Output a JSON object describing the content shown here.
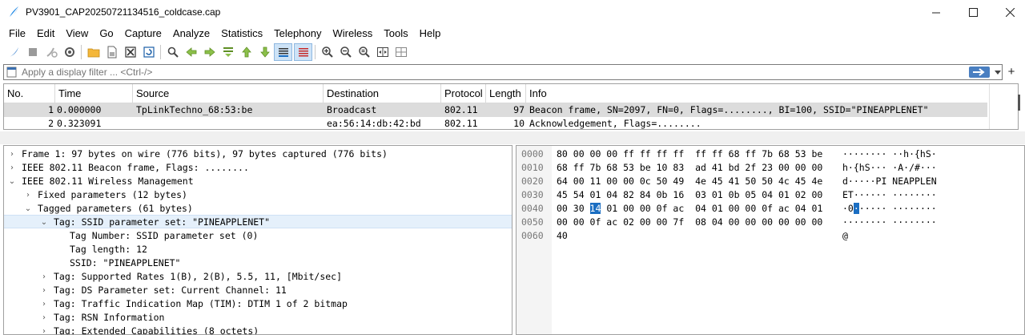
{
  "window": {
    "title": "PV3901_CAP20250721134516_coldcase.cap",
    "minimize": "—",
    "maximize": "☐",
    "close": "✕"
  },
  "menu": {
    "items": [
      "File",
      "Edit",
      "View",
      "Go",
      "Capture",
      "Analyze",
      "Statistics",
      "Telephony",
      "Wireless",
      "Tools",
      "Help"
    ]
  },
  "toolbar": {
    "icons": [
      "shark-fin-icon",
      "stop-icon",
      "restart-icon",
      "options-gear-icon",
      "open-folder-icon",
      "save-icon",
      "close-file-icon",
      "reload-icon",
      "find-icon",
      "go-back-icon",
      "go-forward-icon",
      "go-to-packet-icon",
      "first-packet-icon",
      "last-packet-icon",
      "autoscroll-icon",
      "colorize-icon",
      "zoom-in-icon",
      "zoom-out-icon",
      "zoom-reset-icon",
      "resize-columns-icon",
      "layout-icon"
    ]
  },
  "filter": {
    "placeholder": "Apply a display filter ... <Ctrl-/>",
    "add_button": "+"
  },
  "packet_list": {
    "columns": [
      "No.",
      "Time",
      "Source",
      "Destination",
      "Protocol",
      "Length",
      "Info"
    ],
    "rows": [
      {
        "no": "1",
        "time": "0.000000",
        "source": "TpLinkTechno_68:53:be",
        "destination": "Broadcast",
        "protocol": "802.11",
        "length": "97",
        "info": "Beacon frame, SN=2097, FN=0, Flags=........, BI=100, SSID=\"PINEAPPLENET\""
      },
      {
        "no": "2",
        "time": "0.323091",
        "source": "",
        "destination": "ea:56:14:db:42:bd",
        "protocol": "802.11",
        "length": "10",
        "info": "Acknowledgement, Flags=........"
      }
    ]
  },
  "details": {
    "rows": [
      {
        "arrow": "›",
        "text": "Frame 1: 97 bytes on wire (776 bits), 97 bytes captured (776 bits)"
      },
      {
        "arrow": "›",
        "text": "IEEE 802.11 Beacon frame, Flags: ........"
      },
      {
        "arrow": "⌄",
        "text": "IEEE 802.11 Wireless Management"
      },
      {
        "arrow": "›",
        "text": "Fixed parameters (12 bytes)"
      },
      {
        "arrow": "⌄",
        "text": "Tagged parameters (61 bytes)"
      },
      {
        "arrow": "⌄",
        "text": "Tag: SSID parameter set: \"PINEAPPLENET\""
      },
      {
        "arrow": "",
        "text": "Tag Number: SSID parameter set (0)"
      },
      {
        "arrow": "",
        "text": "Tag length: 12"
      },
      {
        "arrow": "",
        "text": "SSID: \"PINEAPPLENET\""
      },
      {
        "arrow": "›",
        "text": "Tag: Supported Rates 1(B), 2(B), 5.5, 11, [Mbit/sec]"
      },
      {
        "arrow": "›",
        "text": "Tag: DS Parameter set: Current Channel: 11"
      },
      {
        "arrow": "›",
        "text": "Tag: Traffic Indication Map (TIM): DTIM 1 of 2 bitmap"
      },
      {
        "arrow": "›",
        "text": "Tag: RSN Information"
      },
      {
        "arrow": "›",
        "text": "Tag: Extended Capabilities (8 octets)"
      }
    ]
  },
  "bytes": {
    "rows": [
      {
        "offset": "0000",
        "hex_a": "80 00 00 00 ff ff ff ff",
        "hex_b": "ff ff 68 ff 7b 68 53 be",
        "ascii": "········ ··h·{hS·"
      },
      {
        "offset": "0010",
        "hex_a": "68 ff 7b 68 53 be 10 83",
        "hex_b": "ad 41 bd 2f 23 00 00 00",
        "ascii": "h·{hS··· ·A·/#···"
      },
      {
        "offset": "0020",
        "hex_a": "64 00 11 00 00 0c 50 49",
        "hex_b": "4e 45 41 50 50 4c 45 4e",
        "ascii": "d·····PI NEAPPLEN"
      },
      {
        "offset": "0030",
        "hex_a": "45 54 01 04 82 84 0b 16",
        "hex_b": "03 01 0b 05 04 01 02 00",
        "ascii": "ET······ ········"
      },
      {
        "offset": "0040",
        "hex_a_pre": "00 30 ",
        "hex_a_hl": "14",
        "hex_a_post": " 01 00 00 0f ac",
        "hex_b": "04 01 00 00 0f ac 04 01",
        "ascii_pre": "·0",
        "ascii_hl": "·",
        "ascii_post": "····· ········"
      },
      {
        "offset": "0050",
        "hex_a": "00 00 0f ac 02 00 00 7f",
        "hex_b": "08 04 00 00 00 00 00 00",
        "ascii": "········ ········"
      },
      {
        "offset": "0060",
        "hex_a": "40",
        "hex_b": "",
        "ascii": "@"
      }
    ]
  },
  "colors": {
    "accent": "#1b6ec2",
    "selected_row": "#dcdcdc",
    "selected_tree": "#e5f0fb",
    "apply_button": "#4a7fc1"
  }
}
